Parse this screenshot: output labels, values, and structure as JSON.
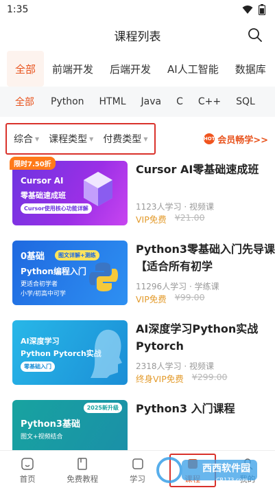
{
  "status": {
    "time": "1:35"
  },
  "header": {
    "title": "课程列表"
  },
  "categories": [
    "全部",
    "前端开发",
    "后端开发",
    "AI人工智能",
    "数据库"
  ],
  "subcategories": [
    "全部",
    "Python",
    "HTML",
    "Java",
    "C",
    "C++",
    "SQL"
  ],
  "filters": {
    "sort": "综合",
    "type": "课程类型",
    "pay": "付费类型",
    "vip": "会员畅学>>",
    "hot": "HOT"
  },
  "courses": [
    {
      "title": "Cursor AI零基础速成班",
      "meta": "1123人学习 · 视频课",
      "price": "VIP免费",
      "original": "¥21.00",
      "badge": "限时7.50折",
      "thumb_lines": [
        "Cursor AI",
        "零基础速成班",
        "Cursor使用核心功能详解"
      ]
    },
    {
      "title": "Python3零基础入门先导课【适合所有初学",
      "meta": "11296人学习 · 学练课",
      "price": "VIP免费",
      "original": "¥99.00",
      "thumb_lines": [
        "0基础",
        "图文详解+测练",
        "Python编程入门",
        "更适合初学者",
        "小学/初高中可学"
      ]
    },
    {
      "title": "AI深度学习Python实战Pytorch",
      "meta": "2318人学习 · 视频课",
      "price": "终身VIP免费",
      "original": "¥299.00",
      "thumb_lines": [
        "AI深度学习",
        "Python Pytorch实战",
        "零基础入门"
      ]
    },
    {
      "title": "Python3 入门课程",
      "meta": "",
      "price": "",
      "original": "",
      "thumb_lines": [
        "2025新升级",
        "Python3基础",
        "图文+视频结合"
      ]
    }
  ],
  "nav": {
    "home": "首页",
    "free": "免费教程",
    "study": "学习",
    "course": "课程",
    "mine": "我的"
  },
  "watermark": {
    "text": "西西软件园",
    "sub": "CR173.com"
  },
  "colors": {
    "accent": "#e8531d",
    "highlight_box": "#d9312a",
    "vip": "#e39a2a"
  }
}
